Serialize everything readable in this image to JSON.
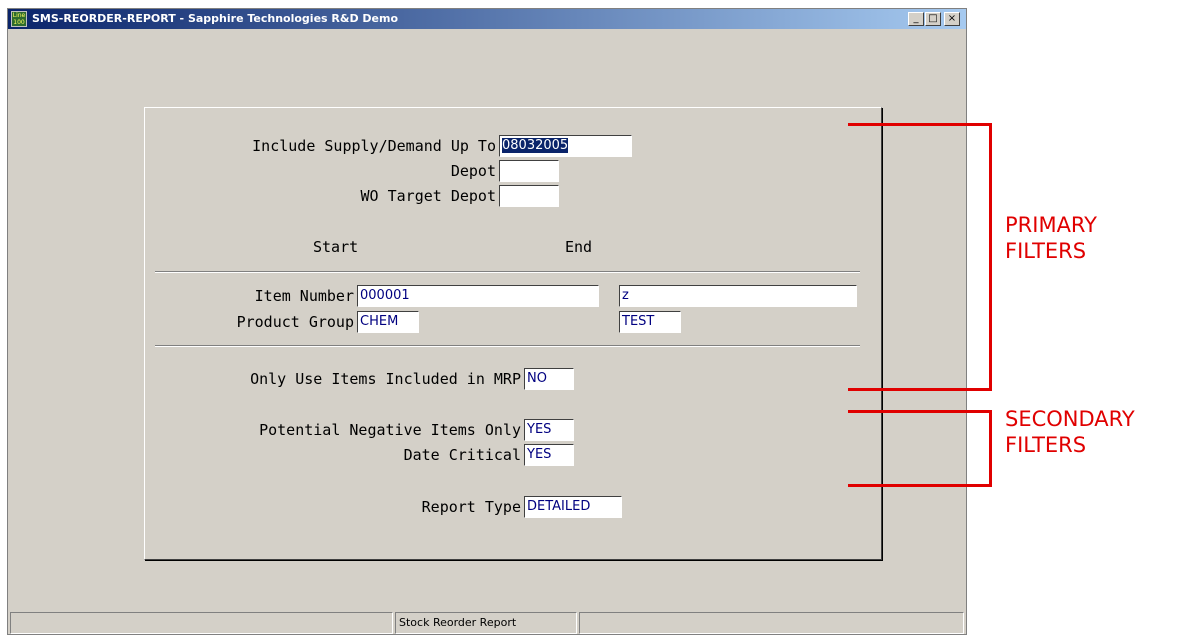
{
  "window": {
    "icon_text": "Line 100",
    "title": "SMS-REORDER-REPORT - Sapphire Technologies R&D Demo",
    "minimize_glyph": "_",
    "maximize_glyph": "□",
    "close_glyph": "×"
  },
  "form": {
    "supply_demand": {
      "label": "Include Supply/Demand Up To",
      "value": "08032005"
    },
    "depot": {
      "label": "Depot",
      "value": ""
    },
    "wo_target_depot": {
      "label": "WO Target Depot",
      "value": ""
    },
    "start_header": "Start",
    "end_header": "End",
    "item_number": {
      "label": "Item Number",
      "start": "000001",
      "end": "z"
    },
    "product_group": {
      "label": "Product Group",
      "start": "CHEM",
      "end": "TEST"
    },
    "mrp_only": {
      "label": "Only Use Items Included in MRP",
      "value": "NO"
    },
    "potential_negative": {
      "label": "Potential Negative Items Only",
      "value": "YES"
    },
    "date_critical": {
      "label": "Date Critical",
      "value": "YES"
    },
    "report_type": {
      "label": "Report Type",
      "value": "DETAILED"
    }
  },
  "statusbar": {
    "left": "",
    "center": "Stock Reorder Report",
    "right": ""
  },
  "annotations": {
    "primary": "PRIMARY\nFILTERS",
    "secondary": "SECONDARY\nFILTERS",
    "color": "#e00000"
  }
}
